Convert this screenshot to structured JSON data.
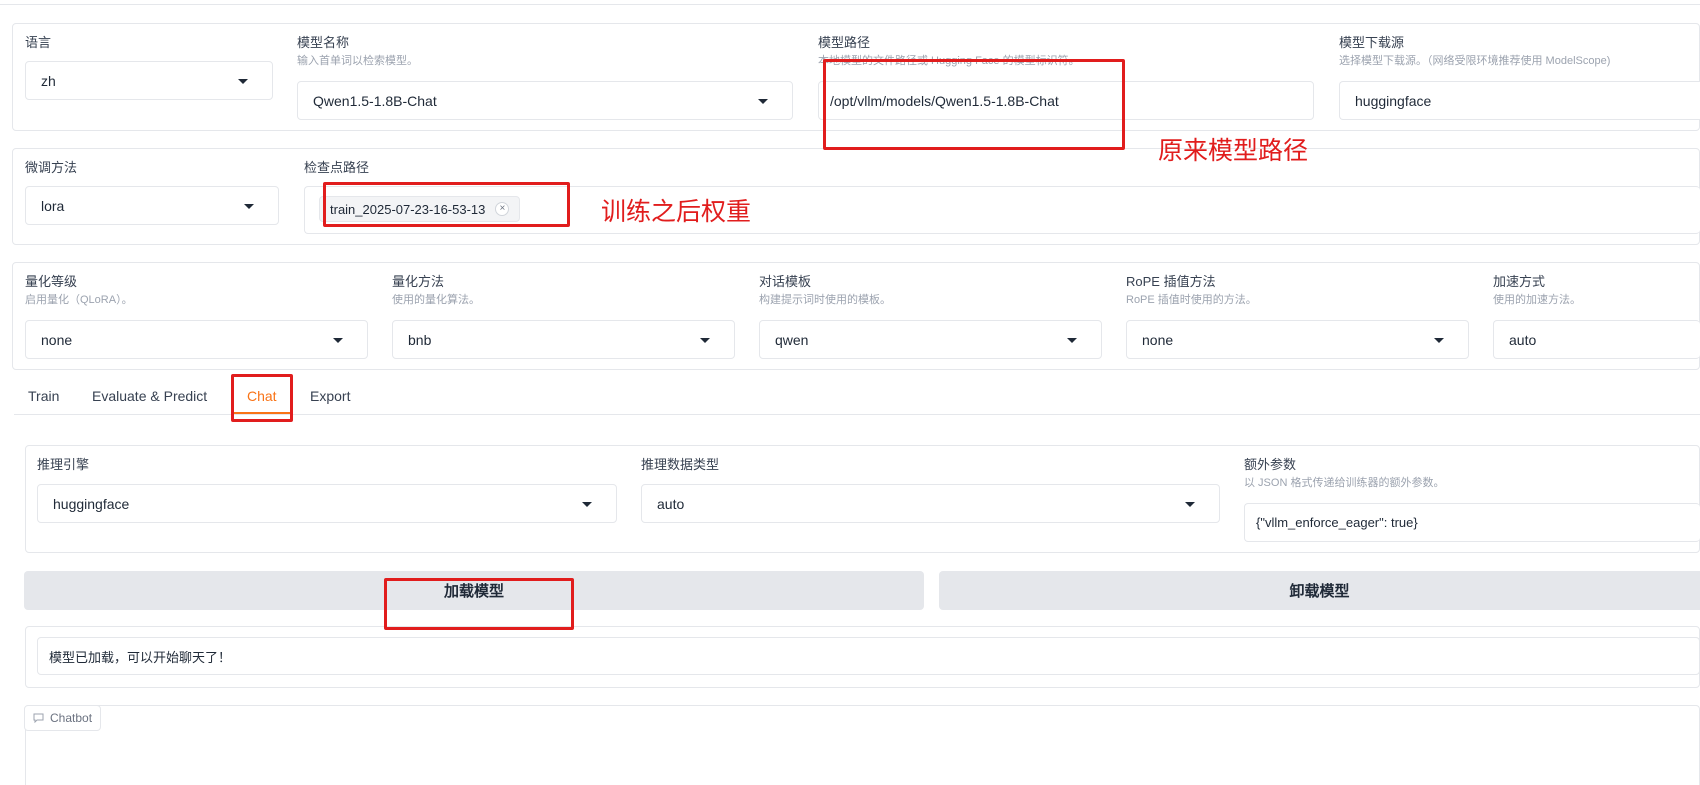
{
  "row1": {
    "language": {
      "label": "语言",
      "value": "zh"
    },
    "model_name": {
      "label": "模型名称",
      "info": "输入首单词以检索模型。",
      "value": "Qwen1.5-1.8B-Chat"
    },
    "model_path": {
      "label": "模型路径",
      "info": "本地模型的文件路径或 Hugging Face 的模型标识符。",
      "value": "/opt/vllm/models/Qwen1.5-1.8B-Chat"
    },
    "download_source": {
      "label": "模型下载源",
      "info": "选择模型下载源。（网络受限环境推荐使用 ModelScope)",
      "value": "huggingface"
    }
  },
  "row2": {
    "finetune_method": {
      "label": "微调方法",
      "value": "lora"
    },
    "checkpoint_path": {
      "label": "检查点路径",
      "chip": "train_2025-07-23-16-53-13",
      "chip_close": "×"
    }
  },
  "row3": {
    "quant_bit": {
      "label": "量化等级",
      "info": "启用量化（QLoRA）。",
      "value": "none"
    },
    "quant_method": {
      "label": "量化方法",
      "info": "使用的量化算法。",
      "value": "bnb"
    },
    "template": {
      "label": "对话模板",
      "info": "构建提示词时使用的模板。",
      "value": "qwen"
    },
    "rope_scaling": {
      "label": "RoPE 插值方法",
      "info": "RoPE 插值时使用的方法。",
      "value": "none"
    },
    "booster": {
      "label": "加速方式",
      "info": "使用的加速方法。",
      "value": "auto"
    }
  },
  "tabs": [
    {
      "label": "Train"
    },
    {
      "label": "Evaluate & Predict"
    },
    {
      "label": "Chat"
    },
    {
      "label": "Export"
    }
  ],
  "chat": {
    "infer_backend": {
      "label": "推理引擎",
      "value": "huggingface"
    },
    "infer_dtype": {
      "label": "推理数据类型",
      "value": "auto"
    },
    "extra_args": {
      "label": "额外参数",
      "info": "以 JSON 格式传递给训练器的额外参数。",
      "value": "{\"vllm_enforce_eager\": true}"
    },
    "load_button": "加载模型",
    "unload_button": "卸载模型",
    "status": "模型已加载，可以开始聊天了！",
    "chatbot_label": "Chatbot"
  },
  "annotations": {
    "model_path_note": "原来模型路径",
    "checkpoint_note": "训练之后权重",
    "color": "#e11d1d"
  }
}
